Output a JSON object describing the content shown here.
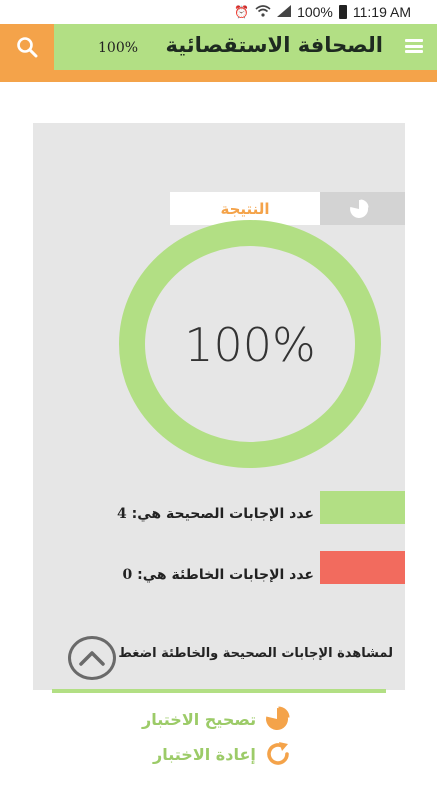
{
  "status_bar": {
    "battery": "100%",
    "time": "11:19 AM"
  },
  "app_bar": {
    "title": "الصحافة الاستقصائية",
    "score_label": "100%",
    "accent": "#b2df84",
    "secondary": "#f4a34a"
  },
  "result": {
    "tab_label": "النتيجة",
    "percentage_text": "100%",
    "percentage": 100,
    "correct_label": "عدد الإجابات الصحيحة هي:",
    "correct_value": "4",
    "wrong_label": "عدد الإجابات الخاطئة هي:",
    "wrong_value": "0",
    "correct_color": "#b2df84",
    "wrong_color": "#f26b5e",
    "view_hint": "لمشاهدة الإجابات الصحيحة والخاطئة اضغط هنا"
  },
  "actions": {
    "correct_quiz": "تصحيح الاختبار",
    "retry_quiz": "إعادة الاختبار"
  },
  "icons": {
    "search": "search-icon",
    "menu": "menu-icon",
    "pie": "pie-chart-icon",
    "up": "chevron-up-icon",
    "retry": "refresh-icon"
  }
}
